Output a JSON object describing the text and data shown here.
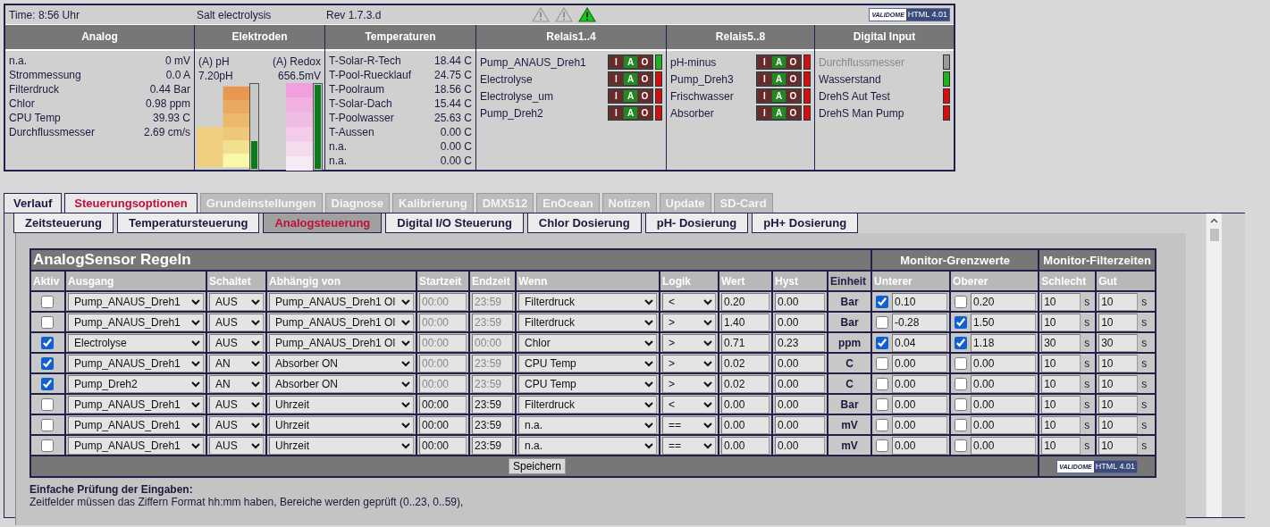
{
  "header": {
    "time": "Time: 8:56 Uhr",
    "title": "Salt electrolysis",
    "revision": "Rev 1.7.3.d",
    "warnings": [
      {
        "active": false
      },
      {
        "active": false
      },
      {
        "active": true
      }
    ],
    "badge": {
      "brand": "VALIDOME",
      "version": "HTML 4.01"
    }
  },
  "analog": {
    "title": "Analog",
    "rows": [
      {
        "label": "n.a.",
        "value": "0 mV"
      },
      {
        "label": "Strommessung",
        "value": "0.0 A"
      },
      {
        "label": "Filterdruck",
        "value": "0.44 Bar"
      },
      {
        "label": "Chlor",
        "value": "0.98 ppm"
      },
      {
        "label": "CPU Temp",
        "value": "39.93 C"
      },
      {
        "label": "Durchflussmesser",
        "value": "2.69 cm/s"
      }
    ]
  },
  "electrodes": {
    "title": "Elektroden",
    "sensors": [
      {
        "kind": "ph",
        "label": "(A) pH",
        "value": "7.20pH",
        "level": 0.33
      },
      {
        "kind": "redox",
        "label": "(A) Redox",
        "value": "656.5mV",
        "level": 1
      }
    ]
  },
  "temperatures": {
    "title": "Temperaturen",
    "rows": [
      {
        "label": "T-Solar-R-Tech",
        "value": "18.44 C"
      },
      {
        "label": "T-Pool-Ruecklauf",
        "value": "24.75 C"
      },
      {
        "label": "T-Poolraum",
        "value": "18.56 C"
      },
      {
        "label": "T-Solar-Dach",
        "value": "15.44 C"
      },
      {
        "label": "T-Poolwasser",
        "value": "25.63 C"
      },
      {
        "label": "T-Aussen",
        "value": "0.00 C"
      },
      {
        "label": "n.a.",
        "value": "0.00 C"
      },
      {
        "label": "n.a.",
        "value": "0.00 C"
      }
    ]
  },
  "relays": [
    {
      "title": "Relais1..4",
      "items": [
        {
          "name": "Pump_ANAUS_Dreh1",
          "on": true,
          "switch": [
            {
              "label": "I",
              "selected": false
            },
            {
              "label": "A",
              "selected": true
            },
            {
              "label": "O",
              "selected": false
            }
          ]
        },
        {
          "name": "Electrolyse",
          "on": false,
          "switch": [
            {
              "label": "I",
              "selected": false
            },
            {
              "label": "A",
              "selected": true
            },
            {
              "label": "O",
              "selected": false
            }
          ]
        },
        {
          "name": "Electrolyse_um",
          "on": false,
          "switch": [
            {
              "label": "I",
              "selected": false
            },
            {
              "label": "A",
              "selected": true
            },
            {
              "label": "O",
              "selected": false
            }
          ]
        },
        {
          "name": "Pump_Dreh2",
          "on": false,
          "switch": [
            {
              "label": "I",
              "selected": false
            },
            {
              "label": "A",
              "selected": true
            },
            {
              "label": "O",
              "selected": false
            }
          ]
        }
      ]
    },
    {
      "title": "Relais5..8",
      "items": [
        {
          "name": "pH-minus",
          "on": false,
          "switch": [
            {
              "label": "I",
              "selected": false
            },
            {
              "label": "A",
              "selected": true
            },
            {
              "label": "O",
              "selected": false
            }
          ]
        },
        {
          "name": "Pump_Dreh3",
          "on": false,
          "switch": [
            {
              "label": "I",
              "selected": false
            },
            {
              "label": "A",
              "selected": true
            },
            {
              "label": "O",
              "selected": false
            }
          ]
        },
        {
          "name": "Frischwasser",
          "on": false,
          "switch": [
            {
              "label": "I",
              "selected": false
            },
            {
              "label": "A",
              "selected": true
            },
            {
              "label": "O",
              "selected": false
            }
          ]
        },
        {
          "name": "Absorber",
          "on": false,
          "switch": [
            {
              "label": "I",
              "selected": false
            },
            {
              "label": "A",
              "selected": true
            },
            {
              "label": "O",
              "selected": false
            }
          ]
        }
      ]
    }
  ],
  "digital_input": {
    "title": "Digital Input",
    "items": [
      {
        "name": "Durchflussmesser",
        "disabled": true
      },
      {
        "name": "Wasserstand",
        "on": true,
        "disabled": false
      },
      {
        "name": "DrehS Aut Test",
        "on": false,
        "disabled": false
      },
      {
        "name": "DrehS Man Pump",
        "on": false,
        "disabled": false
      }
    ]
  },
  "tabs": [
    {
      "label": "Verlauf",
      "selected": false,
      "disabled": false
    },
    {
      "label": "Steuerungsoptionen",
      "selected": true,
      "disabled": false
    },
    {
      "label": "Grundeinstellungen",
      "selected": false,
      "disabled": true
    },
    {
      "label": "Diagnose",
      "selected": false,
      "disabled": true
    },
    {
      "label": "Kalibrierung",
      "selected": false,
      "disabled": true
    },
    {
      "label": "DMX512",
      "selected": false,
      "disabled": true
    },
    {
      "label": "EnOcean",
      "selected": false,
      "disabled": true
    },
    {
      "label": "Notizen",
      "selected": false,
      "disabled": true
    },
    {
      "label": "Update",
      "selected": false,
      "disabled": true
    },
    {
      "label": "SD-Card",
      "selected": false,
      "disabled": true
    }
  ],
  "subtabs": [
    {
      "label": "Zeitsteuerung",
      "selected": false
    },
    {
      "label": "Temperatursteuerung",
      "selected": false
    },
    {
      "label": "Analogsteuerung",
      "selected": true
    },
    {
      "label": "Digital I/O Steuerung",
      "selected": false
    },
    {
      "label": "Chlor Dosierung",
      "selected": false
    },
    {
      "label": "pH- Dosierung",
      "selected": false
    },
    {
      "label": "pH+ Dosierung",
      "selected": false
    }
  ],
  "rules": {
    "title": "AnalogSensor Regeln",
    "groups": [
      "Monitor-Grenzwerte",
      "Monitor-Filterzeiten"
    ],
    "columns": [
      "Aktiv",
      "Ausgang",
      "Schaltet",
      "Abhängig von",
      "Startzeit",
      "Endzeit",
      "Wenn",
      "Logik",
      "Wert",
      "Hyst",
      "Einheit",
      "Unterer",
      "Oberer",
      "Schlecht",
      "Gut"
    ],
    "rows": [
      {
        "active": false,
        "output": "Pump_ANAUS_Dreh1",
        "switches": "AUS",
        "depends": "Pump_ANAUS_Dreh1 Ol",
        "times_disabled": true,
        "start": "00:00",
        "end": "23:59",
        "when": "Filterdruck",
        "logic": "<",
        "value": "0.20",
        "hyst": "0.00",
        "unit": "Bar",
        "lower": {
          "checked": true,
          "value": "0.10"
        },
        "upper": {
          "checked": false,
          "value": "0.20"
        },
        "bad": {
          "value": "10",
          "unit": "s"
        },
        "good": {
          "value": "10",
          "unit": "s"
        }
      },
      {
        "active": false,
        "output": "Pump_ANAUS_Dreh1",
        "switches": "AUS",
        "depends": "Pump_ANAUS_Dreh1 Ol",
        "times_disabled": true,
        "start": "00:00",
        "end": "23:59",
        "when": "Filterdruck",
        "logic": ">",
        "value": "1.40",
        "hyst": "0.00",
        "unit": "Bar",
        "lower": {
          "checked": false,
          "value": "-0.28"
        },
        "upper": {
          "checked": true,
          "value": "1.50"
        },
        "bad": {
          "value": "10",
          "unit": "s"
        },
        "good": {
          "value": "10",
          "unit": "s"
        }
      },
      {
        "active": true,
        "output": "Electrolyse",
        "switches": "AUS",
        "depends": "Pump_ANAUS_Dreh1 Ol",
        "times_disabled": true,
        "start": "00:00",
        "end": "00:00",
        "when": "Chlor",
        "logic": ">",
        "value": "0.71",
        "hyst": "0.23",
        "unit": "ppm",
        "lower": {
          "checked": true,
          "value": "0.04"
        },
        "upper": {
          "checked": true,
          "value": "1.18"
        },
        "bad": {
          "value": "30",
          "unit": "s"
        },
        "good": {
          "value": "30",
          "unit": "s"
        }
      },
      {
        "active": true,
        "output": "Pump_ANAUS_Dreh1",
        "switches": "AN",
        "depends": "Absorber ON",
        "times_disabled": true,
        "start": "00:00",
        "end": "23:59",
        "when": "CPU Temp",
        "logic": ">",
        "value": "0.02",
        "hyst": "0.00",
        "unit": "C",
        "lower": {
          "checked": false,
          "value": "0.00"
        },
        "upper": {
          "checked": false,
          "value": "0.00"
        },
        "bad": {
          "value": "10",
          "unit": "s"
        },
        "good": {
          "value": "10",
          "unit": "s"
        }
      },
      {
        "active": true,
        "output": "Pump_Dreh2",
        "switches": "AN",
        "depends": "Absorber ON",
        "times_disabled": true,
        "start": "00:00",
        "end": "23:59",
        "when": "CPU Temp",
        "logic": ">",
        "value": "0.02",
        "hyst": "0.00",
        "unit": "C",
        "lower": {
          "checked": false,
          "value": "0.00"
        },
        "upper": {
          "checked": false,
          "value": "0.00"
        },
        "bad": {
          "value": "10",
          "unit": "s"
        },
        "good": {
          "value": "10",
          "unit": "s"
        }
      },
      {
        "active": false,
        "output": "Pump_ANAUS_Dreh1",
        "switches": "AUS",
        "depends": "Uhrzeit",
        "times_disabled": false,
        "start": "00:00",
        "end": "23:59",
        "when": "Filterdruck",
        "logic": "<",
        "value": "0.00",
        "hyst": "0.00",
        "unit": "Bar",
        "lower": {
          "checked": false,
          "value": "0.00"
        },
        "upper": {
          "checked": false,
          "value": "0.00"
        },
        "bad": {
          "value": "10",
          "unit": "s"
        },
        "good": {
          "value": "10",
          "unit": "s"
        }
      },
      {
        "active": false,
        "output": "Pump_ANAUS_Dreh1",
        "switches": "AUS",
        "depends": "Uhrzeit",
        "times_disabled": false,
        "start": "00:00",
        "end": "23:59",
        "when": "n.a.",
        "logic": "==",
        "value": "0.00",
        "hyst": "0.00",
        "unit": "mV",
        "lower": {
          "checked": false,
          "value": "0.00"
        },
        "upper": {
          "checked": false,
          "value": "0.00"
        },
        "bad": {
          "value": "10",
          "unit": "s"
        },
        "good": {
          "value": "10",
          "unit": "s"
        }
      },
      {
        "active": false,
        "output": "Pump_ANAUS_Dreh1",
        "switches": "AUS",
        "depends": "Uhrzeit",
        "times_disabled": false,
        "start": "00:00",
        "end": "23:59",
        "when": "n.a.",
        "logic": "==",
        "value": "0.00",
        "hyst": "0.00",
        "unit": "mV",
        "lower": {
          "checked": false,
          "value": "0.00"
        },
        "upper": {
          "checked": false,
          "value": "0.00"
        },
        "bad": {
          "value": "10",
          "unit": "s"
        },
        "good": {
          "value": "10",
          "unit": "s"
        }
      }
    ],
    "save_button": "Speichern",
    "badge": {
      "brand": "VALIDOME",
      "version": "HTML 4.01"
    }
  },
  "notes": {
    "heading": "Einfache Prüfung der Eingaben:",
    "text": "Zeitfelder müssen das Ziffern Format hh:mm haben, Bereiche werden geprüft (0..23, 0..59),"
  }
}
